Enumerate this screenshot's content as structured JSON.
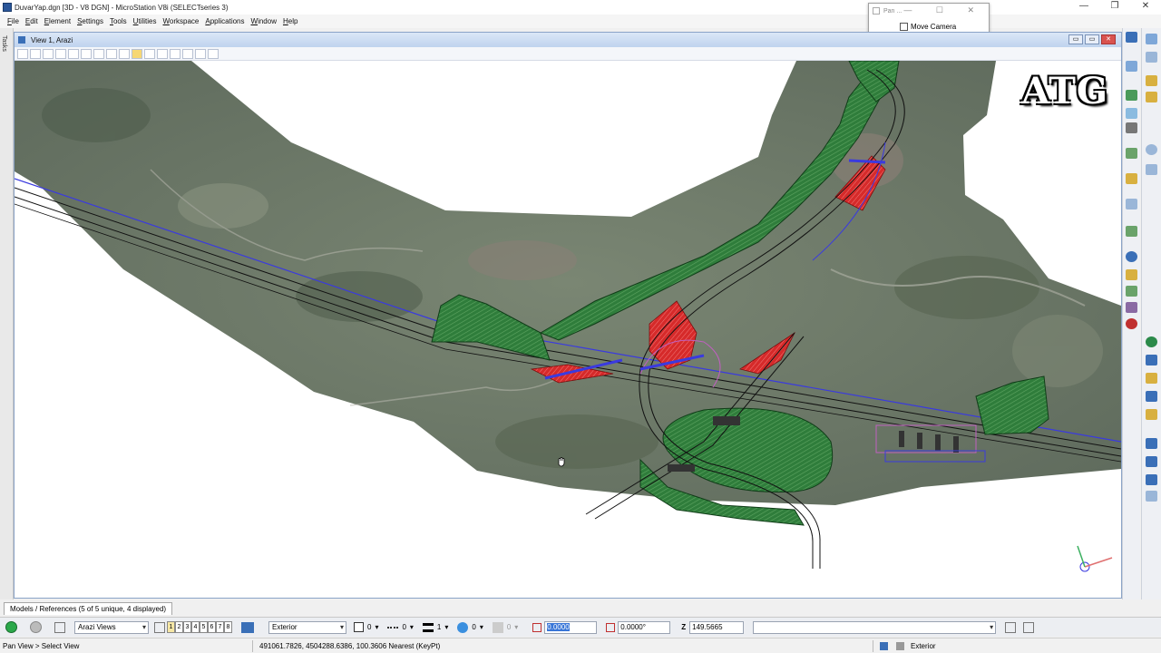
{
  "window": {
    "title": "DuvarYap.dgn [3D - V8 DGN] - MicroStation V8i (SELECTseries 3)",
    "controls": [
      "—",
      "❐",
      "✕"
    ]
  },
  "menu": [
    "File",
    "Edit",
    "Element",
    "Settings",
    "Tools",
    "Utilities",
    "Workspace",
    "Applications",
    "Window",
    "Help"
  ],
  "tasks_label": "Tasks",
  "view": {
    "title": "View 1, Arazi",
    "buttons": [
      "▭",
      "▭",
      "✕"
    ]
  },
  "pan_dialog": {
    "title": "Pan ...",
    "controls": "— ☐ ✕",
    "checkbox_label": "Move Camera",
    "checked": false
  },
  "watermark": "ATG",
  "models_tab": "Models / References (5 of 5 unique, 4 displayed)",
  "attributes": {
    "view_group": "Arazi Views",
    "view_numbers": [
      "1",
      "2",
      "3",
      "4",
      "5",
      "6",
      "7",
      "8"
    ],
    "active_view": "1",
    "level": "Exterior",
    "color": "0",
    "style": "0",
    "weight": "1",
    "transparency": "0",
    "priority": "0",
    "length": "0.0000",
    "angle": "0.0000°",
    "z_label": "Z",
    "z_value": "149.5665"
  },
  "status": {
    "prompt": "Pan View > Select View",
    "coords": "491061.7826, 4504288.6386, 100.3606 Nearest (KeyPt)",
    "level": "Exterior"
  },
  "colors": {
    "terrain": "#6f7a6a",
    "embankment": "#2f7d3b",
    "cut": "#d62a2a",
    "alignment": "#3a3adf",
    "road_edge": "#222222"
  }
}
